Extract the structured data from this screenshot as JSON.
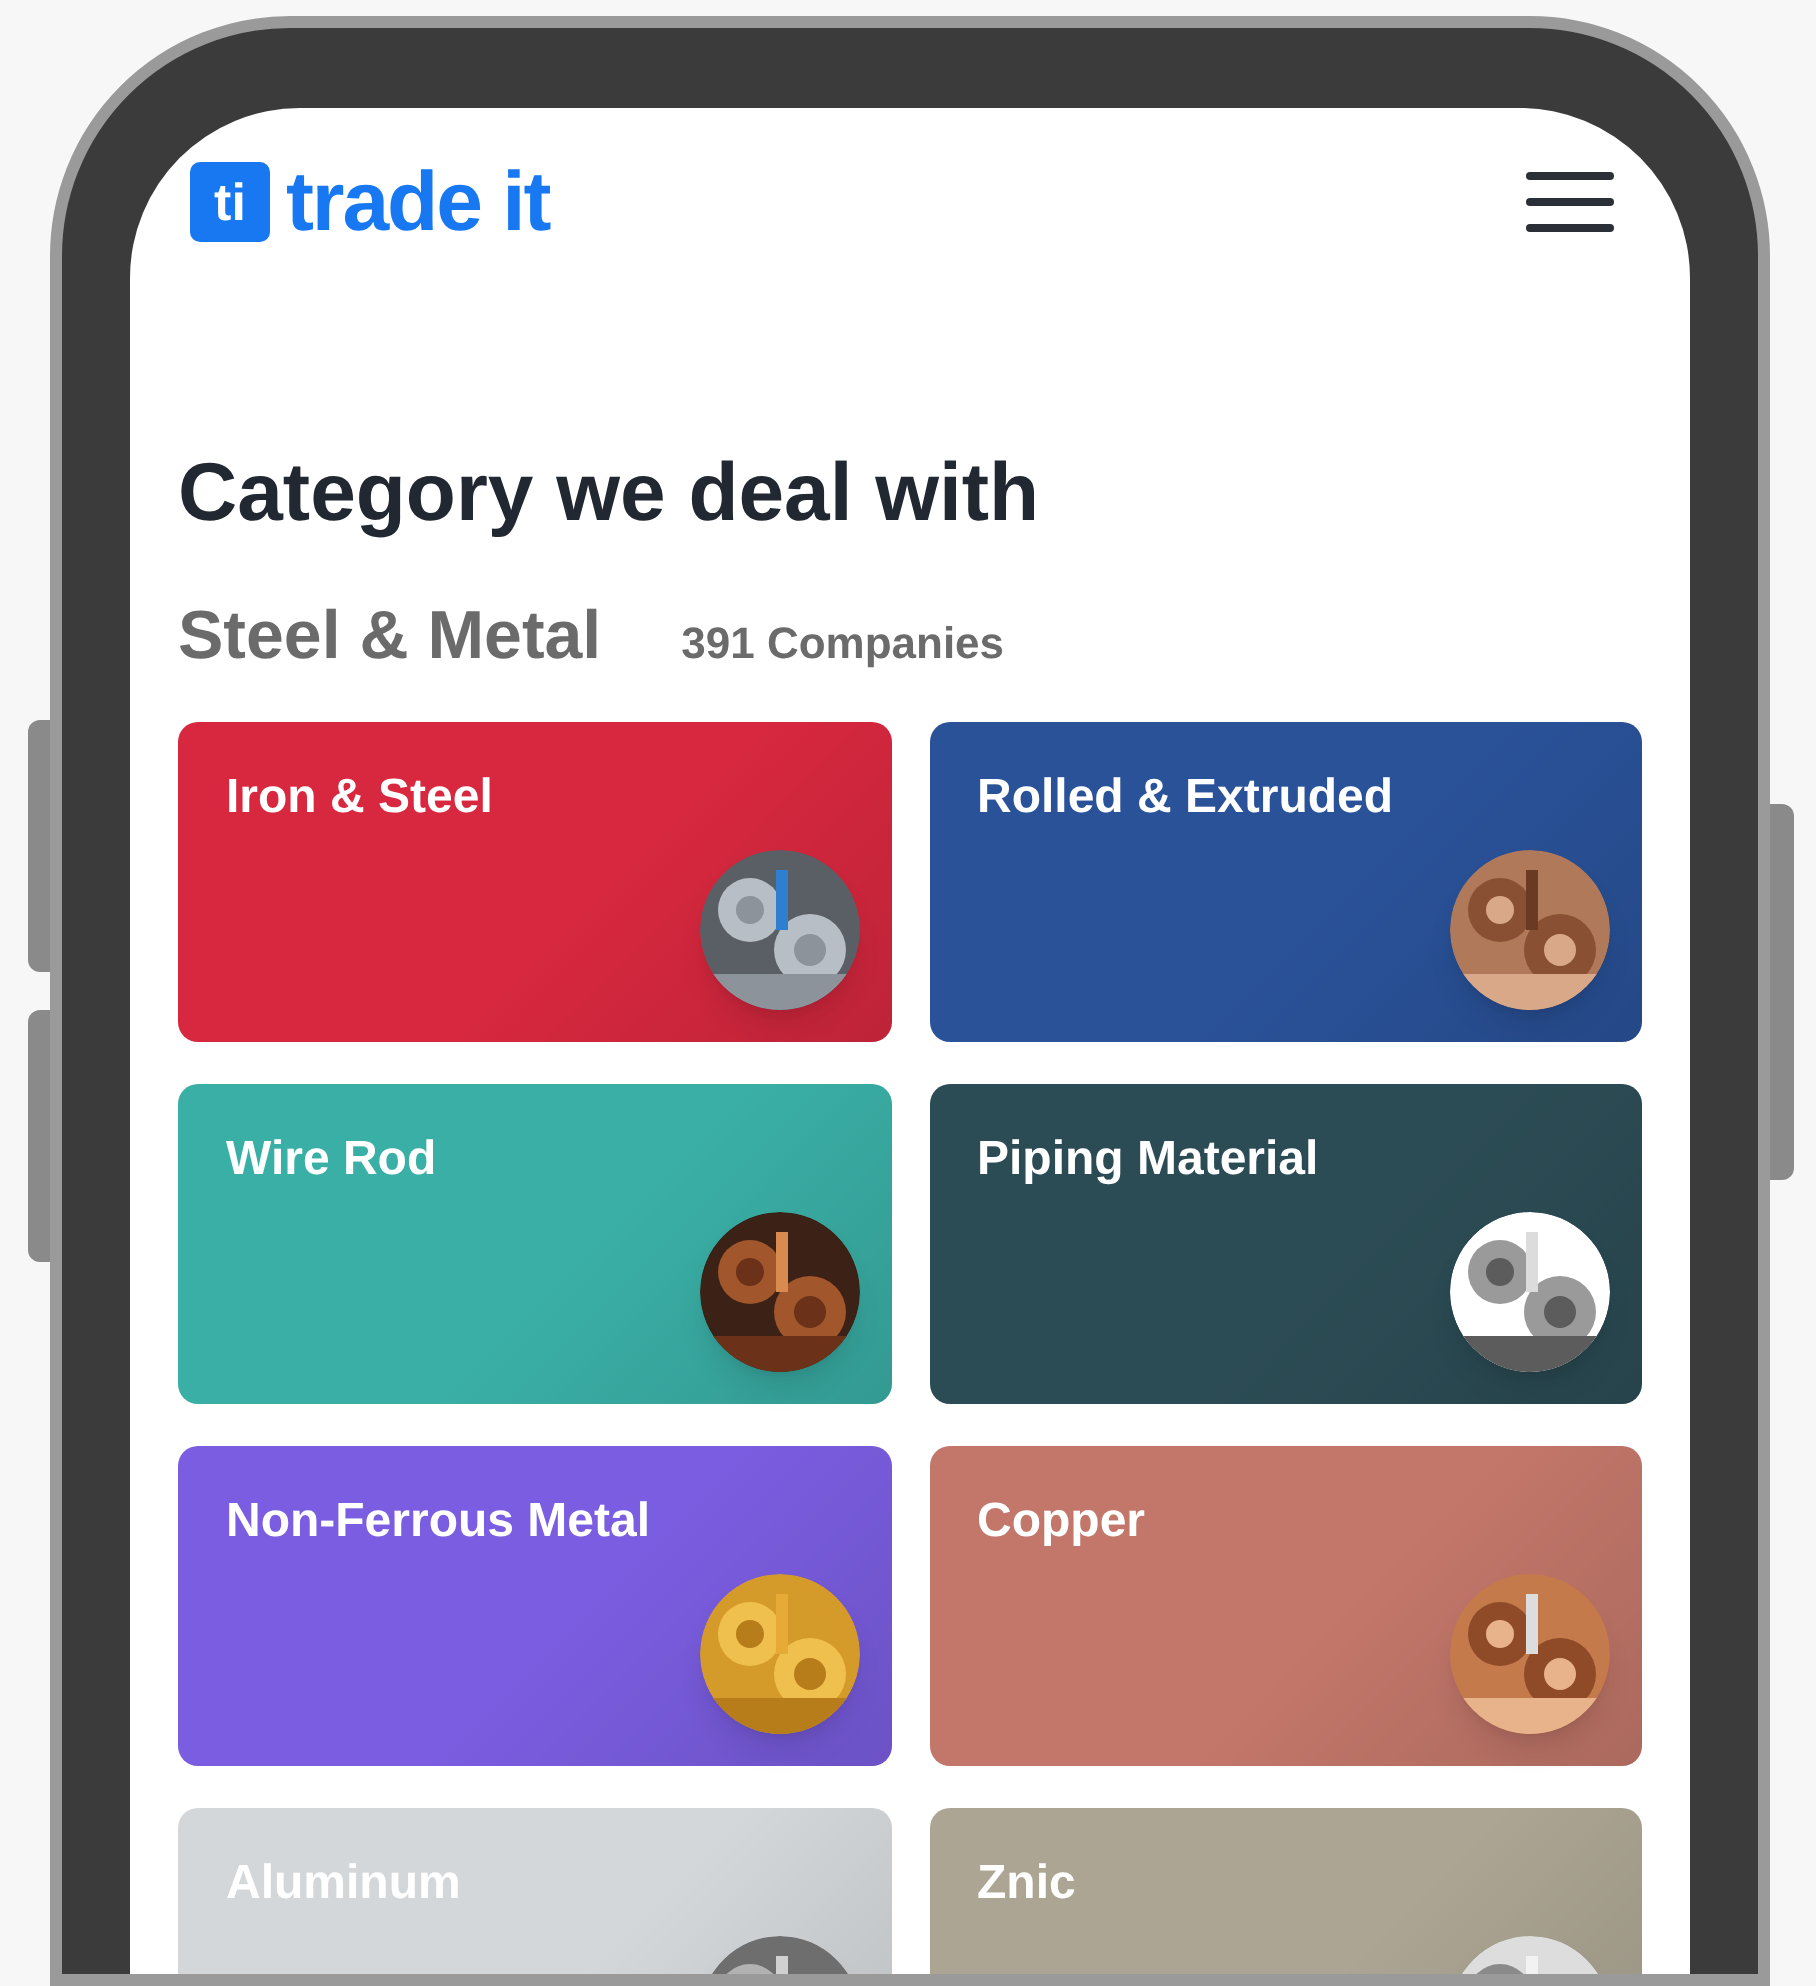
{
  "header": {
    "logo_mark": "ti",
    "logo_text": "trade it"
  },
  "heading": "Category we deal with",
  "section": {
    "title": "Steel & Metal",
    "count": "391 Companies"
  },
  "categories": [
    {
      "label": "Iron & Steel",
      "color": "#d8283f"
    },
    {
      "label": "Rolled & Extruded",
      "color": "#2a5299"
    },
    {
      "label": "Wire Rod",
      "color": "#3aafa6"
    },
    {
      "label": "Piping Material",
      "color": "#2c4c55"
    },
    {
      "label": "Non-Ferrous Metal",
      "color": "#7a5de0"
    },
    {
      "label": "Copper",
      "color": "#c3776a"
    },
    {
      "label": "Aluminum",
      "color": "#d4d7da"
    },
    {
      "label": "Znic",
      "color": "#aca593"
    }
  ]
}
